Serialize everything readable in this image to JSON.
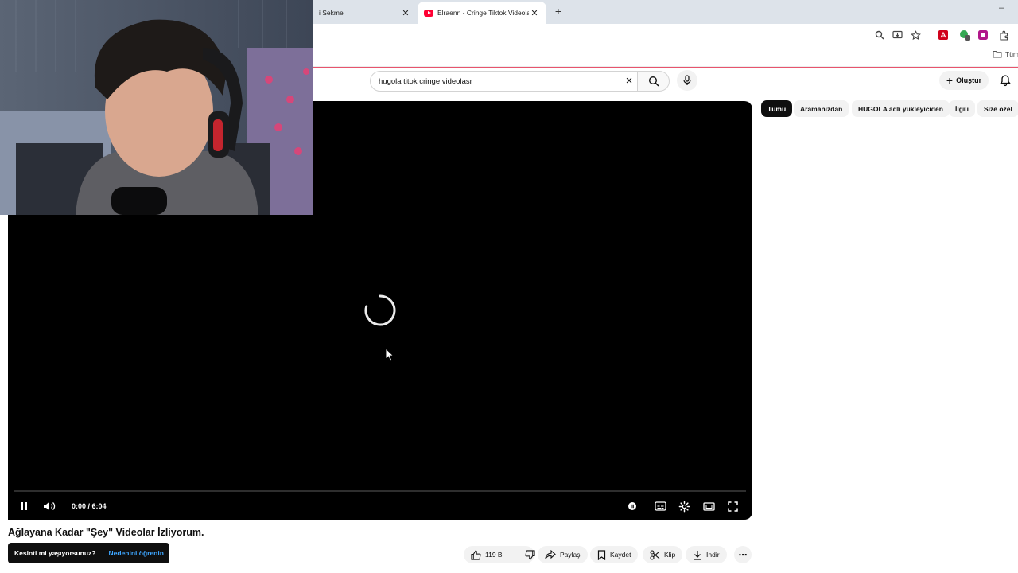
{
  "browser": {
    "tabs": [
      {
        "title": "i Sekme",
        "active": false
      },
      {
        "title": "Elraenn - Cringe Tiktok Videola",
        "active": true
      }
    ],
    "bookmark_label": "Tüm"
  },
  "header": {
    "search_value": "hugola titok cringe videolasr",
    "create_label": "Oluştur"
  },
  "chips": [
    "Tümü",
    "Aramanızdan",
    "HUGOLA adlı yükleyiciden",
    "İlgili",
    "Size özel"
  ],
  "player": {
    "time": "0:00 / 6:04",
    "state": "loading",
    "progress": 0
  },
  "video": {
    "title": "Ağlayana Kadar \"Şey\" Videolar İzliyorum."
  },
  "toast": {
    "message": "Kesinti mi yaşıyorsunuz?",
    "link": "Nedenini öğrenin"
  },
  "actions": {
    "likes": "119 B",
    "share": "Paylaş",
    "save": "Kaydet",
    "clip": "Klip",
    "download": "İndir"
  },
  "colors": {
    "accent": "#ff0033",
    "link": "#3ea6ff",
    "chip_selected": "#0f0f0f"
  }
}
